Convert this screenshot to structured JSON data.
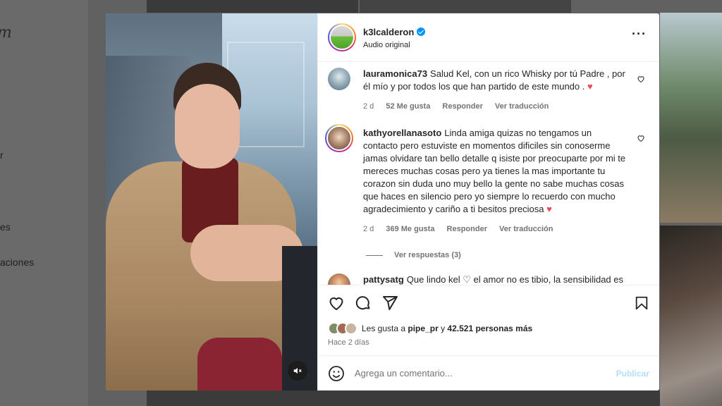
{
  "background": {
    "logo_partial": "m",
    "nav_partial": [
      "r",
      "es",
      "aciones"
    ]
  },
  "post": {
    "author": "k3lcalderon",
    "verified": true,
    "audio": "Audio original",
    "more_icon": "more-horizontal-icon",
    "media_mute_icon": "speaker-muted-icon"
  },
  "comments": [
    {
      "username": "lauramonica73",
      "text": "Salud Kel, con un rico Whisky por tú Padre , por él mío y por todos los que han partido de este mundo . ♥",
      "time": "2 d",
      "likes": "52 Me gusta",
      "reply": "Responder",
      "translate": "Ver traducción"
    },
    {
      "username": "kathyorellanasoto",
      "text": "Linda amiga quizas no tengamos un contacto pero estuviste en momentos dificiles sin conoserme jamas olvidare tan bello detalle q isiste por preocuparte por mi te mereces muchas cosas pero ya tienes la mas importante tu corazon sin duda uno muy bello la gente no sabe muchas cosas que haces en silencio pero yo siempre lo recuerdo con mucho agradecimiento y cariño a ti besitos preciosa ♥",
      "time": "2 d",
      "likes": "369 Me gusta",
      "reply": "Responder",
      "translate": "Ver traducción",
      "view_replies": "Ver respuestas (3)"
    },
    {
      "username": "pattysatg",
      "text": "Que lindo kel ♡ el amor no es tibio, la sensibilidad es"
    }
  ],
  "likes": {
    "prefix": "Les gusta a",
    "user": "pipe_pr",
    "joiner": "y",
    "others": "42.521 personas más"
  },
  "time_ago": "Hace 2 días",
  "comment_box": {
    "placeholder": "Agrega un comentario...",
    "publish": "Publicar"
  },
  "colors": {
    "accent": "#0095f6",
    "publish_disabled": "#b2dffc",
    "heart_red": "#ed4956"
  }
}
